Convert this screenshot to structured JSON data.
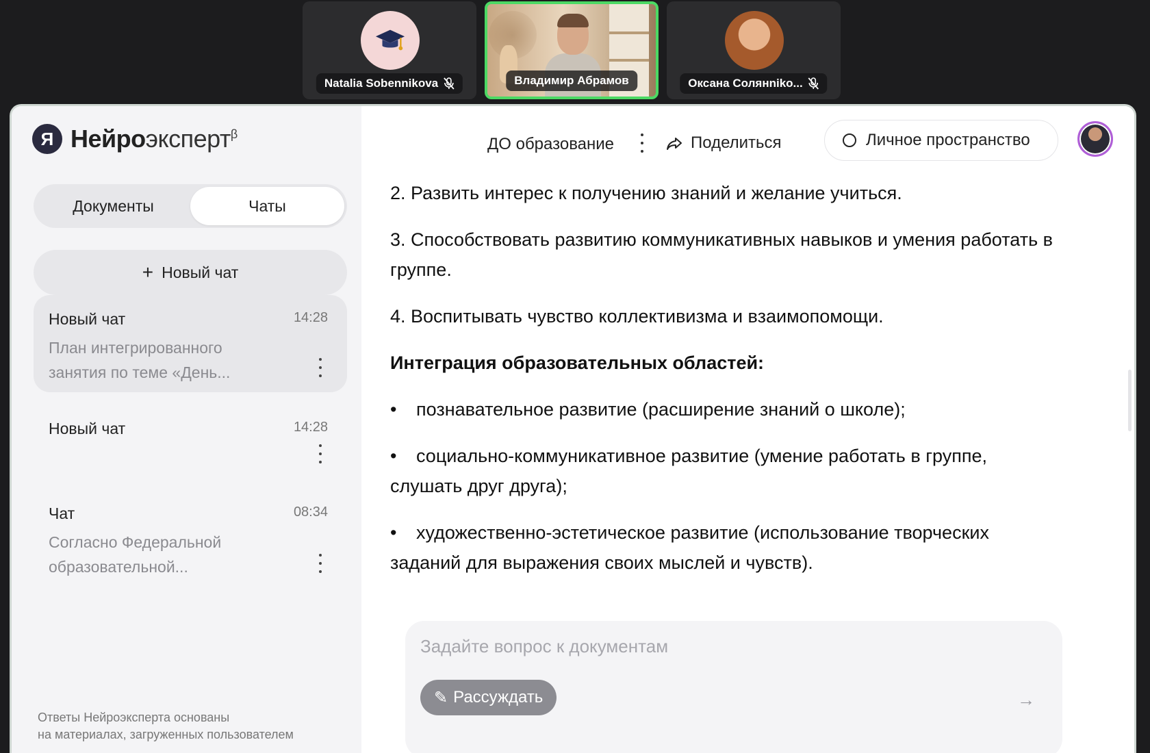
{
  "call": {
    "participants": [
      {
        "name": "Natalia Sobennikova",
        "muted": true,
        "avatar": "graduation-cap-icon"
      },
      {
        "name": "Владимир Абрамов",
        "muted": false,
        "speaking": true,
        "video": "camera-feed"
      },
      {
        "name": "Оксана Солянniko...",
        "muted": true,
        "avatar": "photo"
      }
    ],
    "active_speaker_color": "#4cd964"
  },
  "app": {
    "brand": {
      "logo": "Я",
      "name_bold": "Нейро",
      "name_light": "эксперт",
      "beta": "β"
    },
    "sidebar": {
      "tabs": [
        {
          "label": "Документы",
          "active": false
        },
        {
          "label": "Чаты",
          "active": true
        }
      ],
      "new_chat_label": "Новый чат",
      "chats": [
        {
          "title": "Новый чат",
          "time": "14:28",
          "preview": "План интегрированного занятия по теме «День...",
          "selected": true
        },
        {
          "title": "Новый чат",
          "time": "14:28",
          "preview": "",
          "selected": false
        },
        {
          "title": "Чат",
          "time": "08:34",
          "preview": "Согласно Федеральной образовательной...",
          "selected": false
        }
      ],
      "disclaimer_line1": "Ответы Нейроэксперта основаны",
      "disclaimer_line2": "на материалах, загруженных пользователем"
    },
    "topbar": {
      "project": "ДО образование",
      "share_label": "Поделиться",
      "space_label": "Личное пространство"
    },
    "message": {
      "p2": "2. Развить интерес к получению знаний и желание учиться.",
      "p3": "3. Способствовать развитию коммуникативных навыков и умения работать в группе.",
      "p4": "4. Воспитывать чувство коллективизма и взаимопомощи.",
      "integration_heading": "Интеграция образовательных областей:",
      "bullets": [
        "познавательное развитие (расширение знаний о школе);",
        "социально-коммуникативное развитие (умение работать в группе, слушать друг друга);",
        "художественно-эстетическое развитие (использование творческих заданий для выражения своих мыслей и чувств)."
      ]
    },
    "composer": {
      "placeholder": "Задайте вопрос к документам",
      "reason_label": "Рассуждать"
    }
  }
}
